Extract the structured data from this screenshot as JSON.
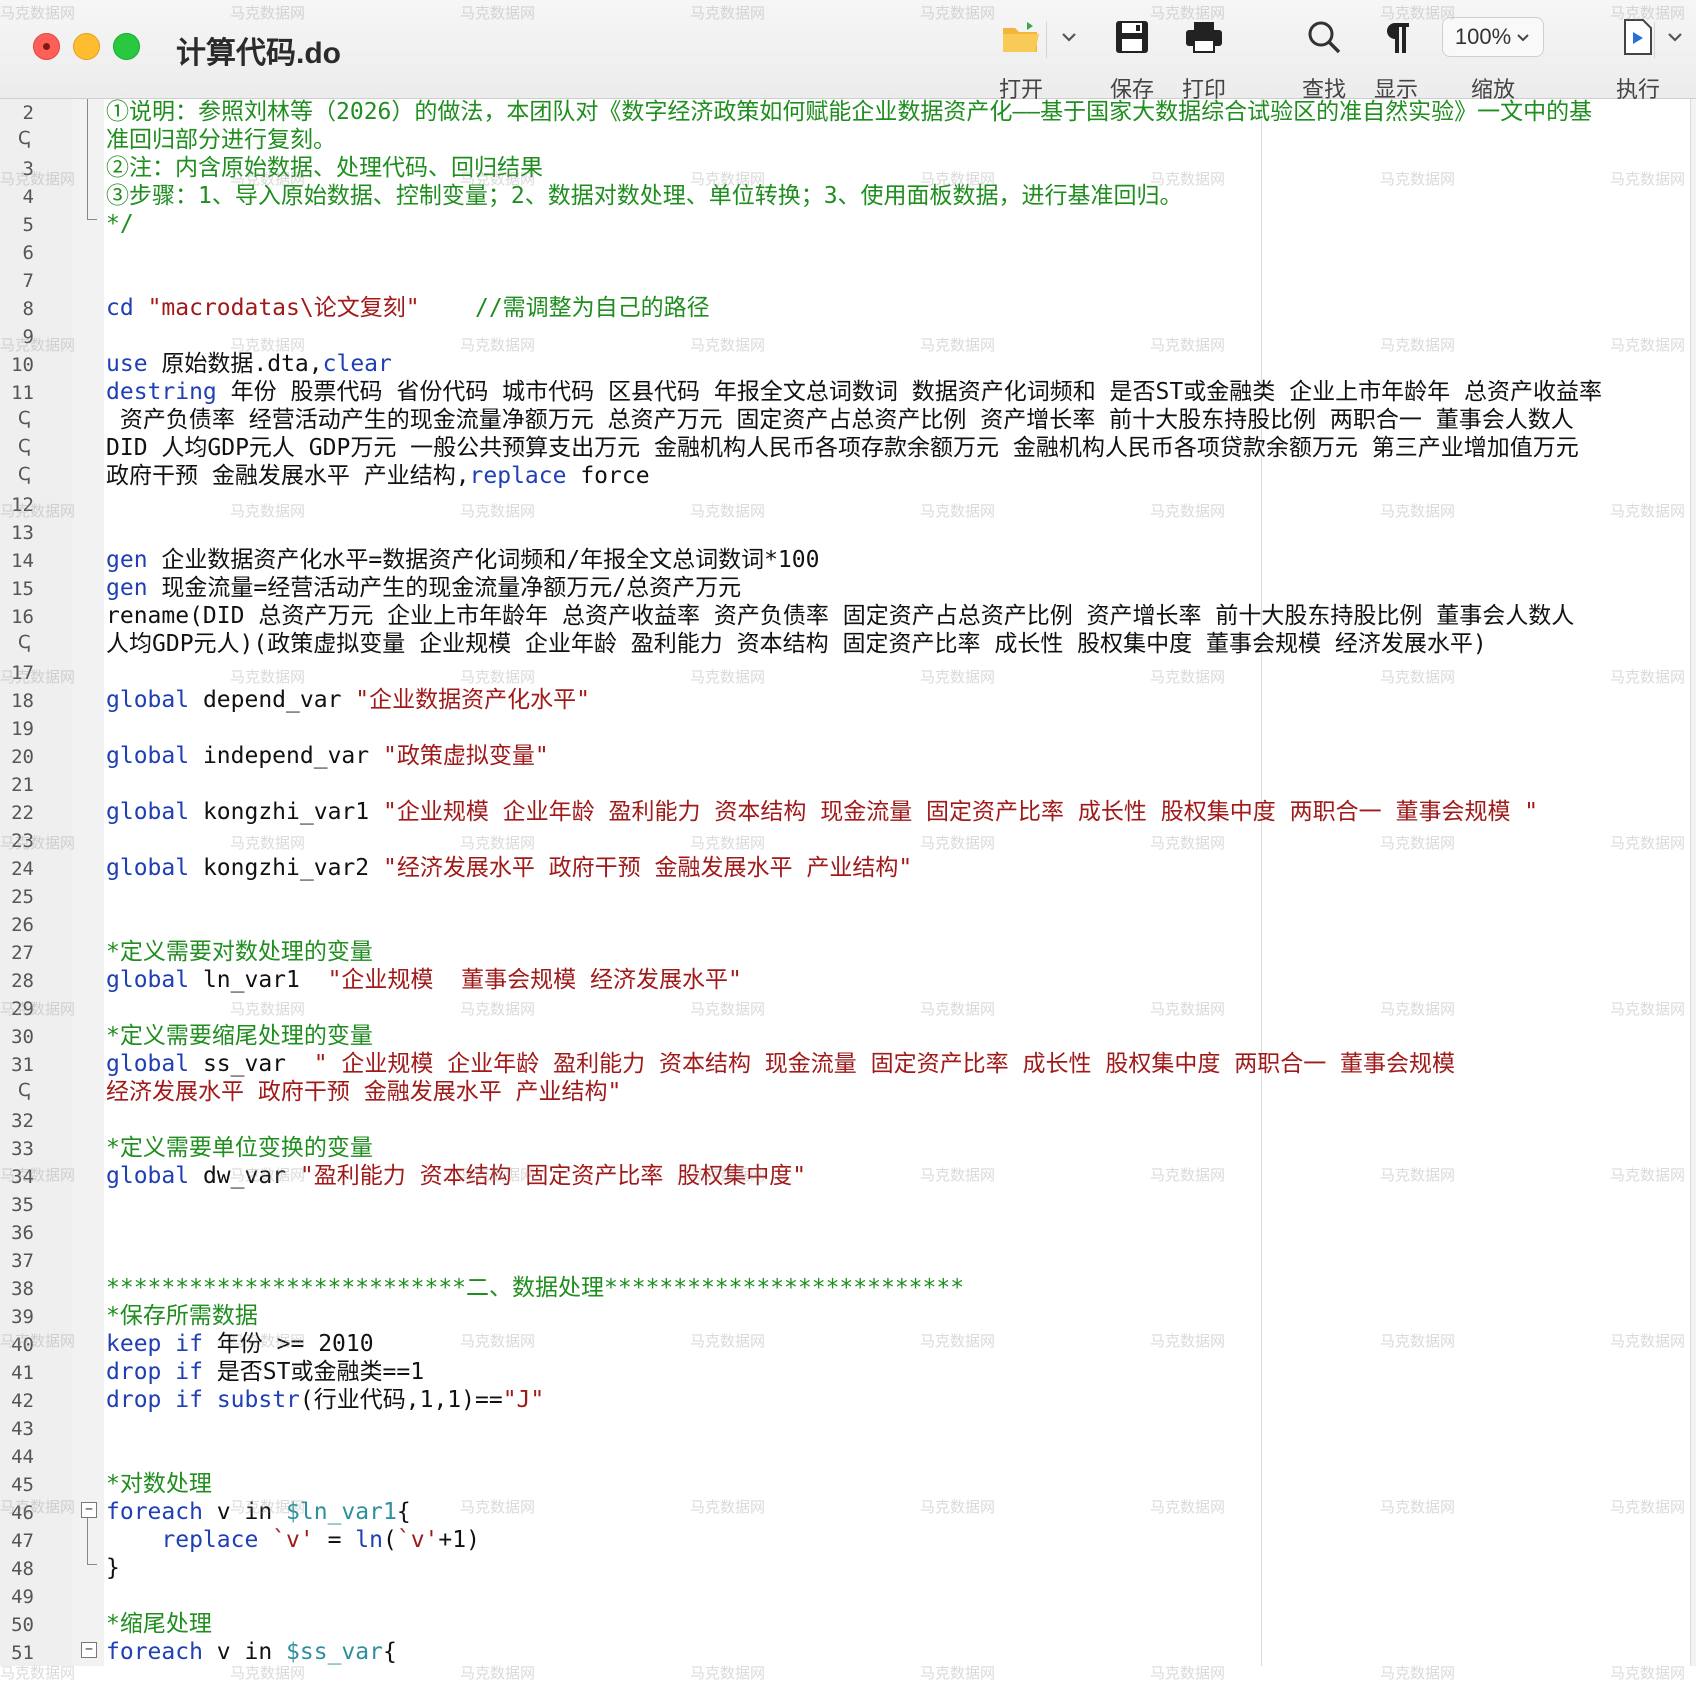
{
  "window": {
    "title": "计算代码.do"
  },
  "toolbar": {
    "open_label": "打开",
    "save_label": "保存",
    "print_label": "打印",
    "find_label": "查找",
    "show_label": "显示",
    "zoom_label": "缩放",
    "zoom_value": "100%",
    "run_label": "执行"
  },
  "watermark": "马克数据网",
  "editor": {
    "line_numbers": [
      "2",
      "3",
      "4",
      "5",
      "6",
      "7",
      "8",
      "9",
      "10",
      "11",
      "12",
      "13",
      "14",
      "15",
      "16",
      "17",
      "18",
      "19",
      "20",
      "21",
      "22",
      "23",
      "24",
      "25",
      "26",
      "27",
      "28",
      "29",
      "30",
      "31",
      "32",
      "33",
      "34",
      "35",
      "36",
      "37",
      "38",
      "39",
      "40",
      "41",
      "42",
      "43",
      "44",
      "45",
      "46",
      "47",
      "48",
      "49",
      "50",
      "51"
    ],
    "wrap_marker": "ↅ",
    "fold_open": "−",
    "lines": {
      "l2a": "①说明：参照刘林等（2026）的做法，本团队对《数字经济政策如何赋能企业数据资产化——基于国家大数据综合试验区的准自然实验》一文中的基",
      "l2b": "准回归部分进行复刻。",
      "l3": "②注：内含原始数据、处理代码、回归结果",
      "l4": "③步骤：1、导入原始数据、控制变量；2、数据对数处理、单位转换；3、使用面板数据，进行基准回归。",
      "l5": "*/",
      "l8_kw": "cd",
      "l8_str": "\"macrodatas\\论文复刻\"",
      "l8_cmt": "//需调整为自己的路径",
      "l10_kw": "use",
      "l10_txt": " 原始数据.dta,",
      "l10_kw2": "clear",
      "l11_kw": "destring",
      "l11a": " 年份 股票代码 省份代码 城市代码 区县代码 年报全文总词数词 数据资产化词频和 是否ST或金融类 企业上市年龄年 总资产收益率",
      "l11b": " 资产负债率 经营活动产生的现金流量净额万元 总资产万元 固定资产占总资产比例 资产增长率 前十大股东持股比例 两职合一 董事会人数人",
      "l11c": "DID 人均GDP元人 GDP万元 一般公共预算支出万元 金融机构人民币各项存款余额万元 金融机构人民币各项贷款余额万元 第三产业增加值万元",
      "l11d": "政府干预 金融发展水平 产业结构,",
      "l11d_kw": "replace",
      "l11d_tail": " force",
      "l14_kw": "gen",
      "l14": " 企业数据资产化水平=数据资产化词频和/年报全文总词数词*100",
      "l15_kw": "gen",
      "l15": " 现金流量=经营活动产生的现金流量净额万元/总资产万元",
      "l16a": "rename(DID 总资产万元 企业上市年龄年 总资产收益率 资产负债率 固定资产占总资产比例 资产增长率 前十大股东持股比例 董事会人数人",
      "l16b": "人均GDP元人)(政策虚拟变量 企业规模 企业年龄 盈利能力 资本结构 固定资产比率 成长性 股权集中度 董事会规模 经济发展水平)",
      "global_kw": "global",
      "l18_var": " depend_var ",
      "l18_str": "\"企业数据资产化水平\"",
      "l20_var": " independ_var ",
      "l20_str": "\"政策虚拟变量\"",
      "l22_var": " kongzhi_var1 ",
      "l22_str": "\"企业规模 企业年龄 盈利能力 资本结构 现金流量 固定资产比率 成长性 股权集中度 两职合一 董事会规模 \"",
      "l24_var": " kongzhi_var2 ",
      "l24_str": "\"经济发展水平 政府干预 金融发展水平 产业结构\"",
      "l27": "*定义需要对数处理的变量",
      "l28_var": " ln_var1  ",
      "l28_str": "\"企业规模  董事会规模 经济发展水平\"",
      "l29": "*定义需要缩尾处理的变量",
      "l31_var": " ss_var  ",
      "l31a_str": "\" 企业规模 企业年龄 盈利能力 资本结构 现金流量 固定资产比率 成长性 股权集中度 两职合一 董事会规模",
      "l31b_str": "经济发展水平 政府干预 金融发展水平 产业结构\"",
      "l33": "*定义需要单位变换的变量",
      "l34_var": " dw_var ",
      "l34_str": "\"盈利能力 资本结构 固定资产比率 股权集中度\"",
      "l38": "**************************二、数据处理**************************",
      "l39": "*保存所需数据",
      "keep_kw": "keep",
      "drop_kw": "drop",
      "if_kw": "if",
      "l40_tail": " 年份 >= 2010",
      "l41_tail": " 是否ST或金融类==1",
      "l42_fn": "substr",
      "l42_mid": "(行业代码,1,1)==",
      "l42_str": "\"J\"",
      "l45": "*对数处理",
      "foreach_kw": "foreach",
      "l46_mid": " v in ",
      "l46_mac": "$ln_var1",
      "brace_open": "{",
      "l47_indent": "    ",
      "l47_kw": "replace",
      "l47_str": " `v' ",
      "l47_eq": "= ",
      "l47_fn": "ln",
      "l47_paren": "(",
      "l47_str2": "`v'",
      "l47_tail": "+1)",
      "brace_close": "}",
      "l50": "*缩尾处理",
      "l51_mac": "$ss_var"
    }
  },
  "colors": {
    "keyword": "#1f3fb5",
    "string": "#a11a1a",
    "comment": "#1f8e1f",
    "macro": "#2e8f9d"
  }
}
